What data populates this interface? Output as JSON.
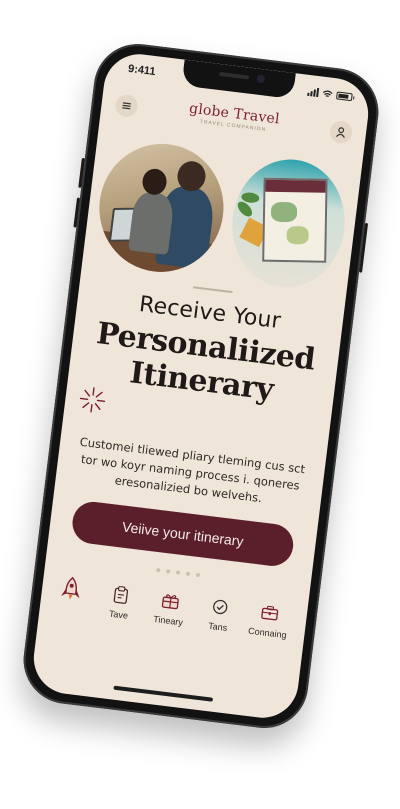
{
  "status_bar": {
    "time": "9:411"
  },
  "header": {
    "brand": "globe Travel",
    "brand_tagline": "TRAVEL COMPANION",
    "menu_icon": "menu-icon",
    "profile_icon": "user-icon"
  },
  "hero": {
    "images": [
      "people-planning-photo",
      "map-itinerary-photo"
    ]
  },
  "headline": {
    "line1": "Receive Your",
    "line2": "Personaliized",
    "line3": "Itinerary"
  },
  "description": "Customei tliewed pliary tleming cus sct tor wo koyr naming process i. qoneres eresonalizied bo welvehs.",
  "cta": {
    "label": "Veiive your itinerary"
  },
  "pager": {
    "total": 5,
    "active": 0
  },
  "tabbar": {
    "items": [
      {
        "label": "",
        "icon": "rocket-icon"
      },
      {
        "label": "Tave",
        "icon": "clipboard-icon"
      },
      {
        "label": "Tineary",
        "icon": "gift-icon"
      },
      {
        "label": "Tans",
        "icon": "check-circle-icon"
      },
      {
        "label": "Connaing",
        "icon": "briefcase-icon"
      }
    ]
  },
  "colors": {
    "accent": "#5b1f2b",
    "brand": "#7b1f2e",
    "background": "#efe5d9"
  }
}
